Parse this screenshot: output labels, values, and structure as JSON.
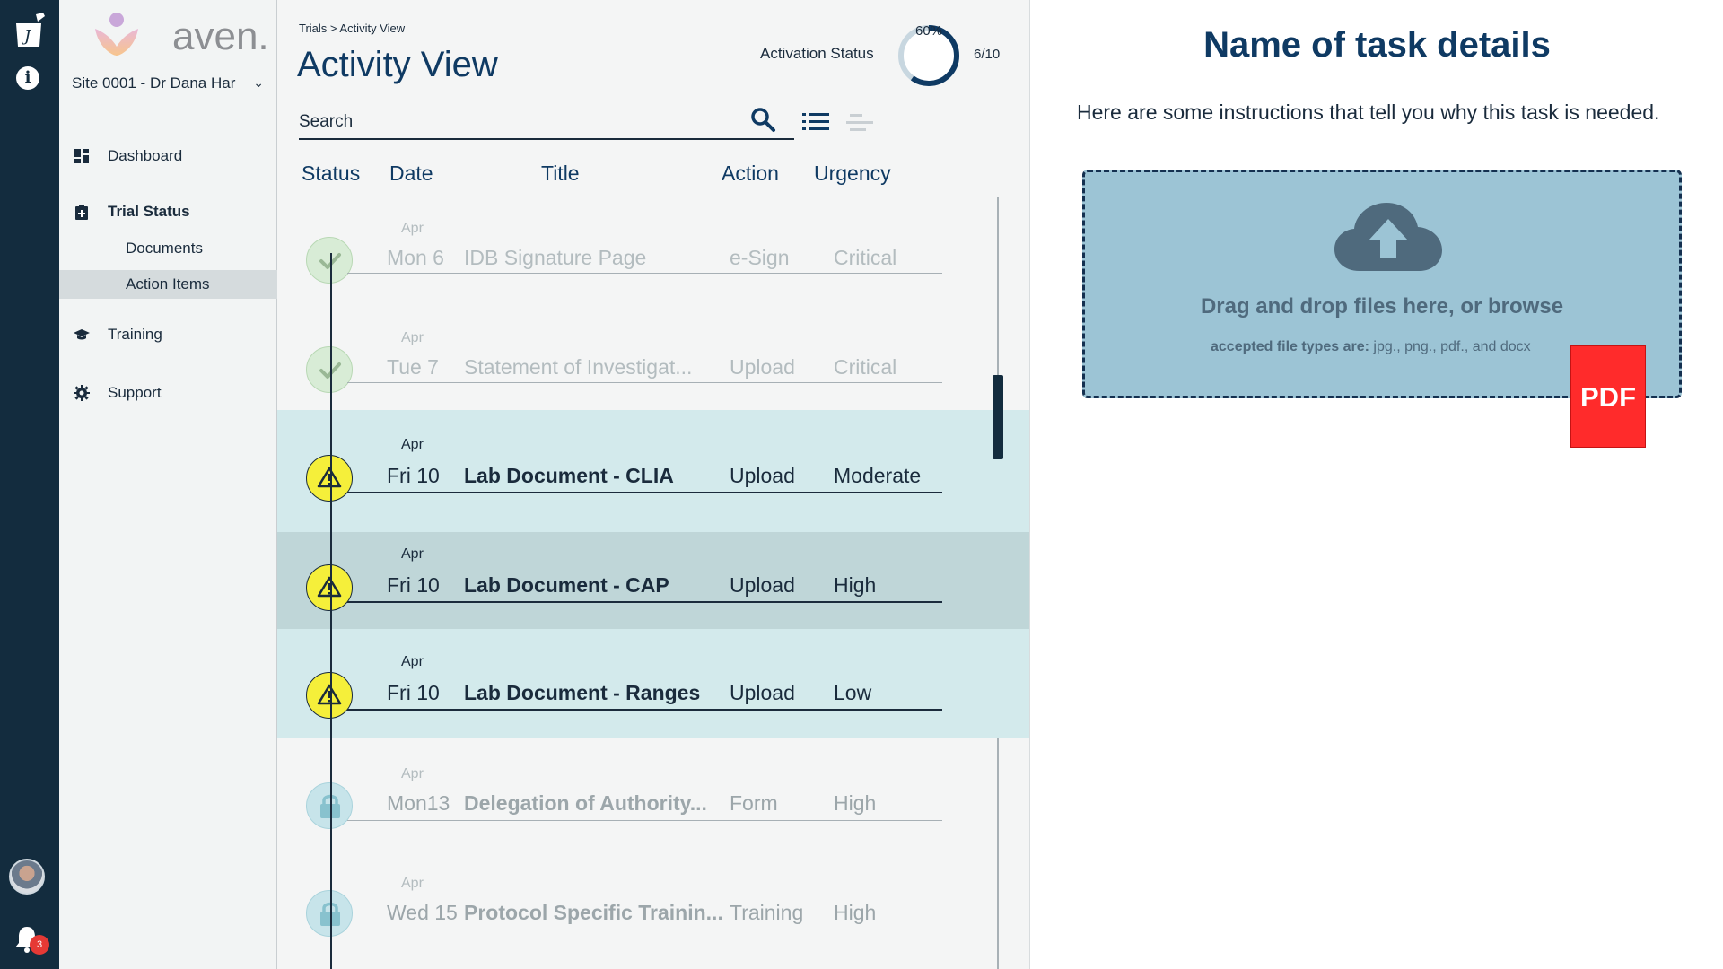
{
  "rail": {
    "logo_icon": "mortar-pestle-logo-icon",
    "info_icon": "info-icon",
    "info_glyph": "i",
    "avatar_icon": "user-avatar",
    "bell_icon": "bell-icon",
    "notification_count": "3"
  },
  "sidebar": {
    "brand": "aven.",
    "site_selector": "Site 0001 - Dr Dana Har",
    "site_chevron": "⌄",
    "nav": {
      "dashboard": "Dashboard",
      "trial_status": "Trial Status",
      "documents": "Documents",
      "action_items": "Action Items",
      "training": "Training",
      "support": "Support"
    }
  },
  "header": {
    "breadcrumb": "Trials > Activity View",
    "title": "Activity View",
    "activation_label": "Activation Status",
    "activation_percent_text": "60%",
    "activation_fraction": 0.6,
    "activation_count": "6/10",
    "search_placeholder": "Search"
  },
  "columns": {
    "status": "Status",
    "date": "Date",
    "title": "Title",
    "action": "Action",
    "urgency": "Urgency"
  },
  "rows": [
    {
      "month": "Apr",
      "day": "Mon 6",
      "title": "IDB Signature Page",
      "action": "e-Sign",
      "urgency": "Critical",
      "status": "complete"
    },
    {
      "month": "Apr",
      "day": "Tue 7",
      "title": "Statement of Investigat...",
      "action": "Upload",
      "urgency": "Critical",
      "status": "complete"
    },
    {
      "month": "Apr",
      "day": "Fri 10",
      "title": "Lab Document - CLIA",
      "action": "Upload",
      "urgency": "Moderate",
      "status": "warning"
    },
    {
      "month": "Apr",
      "day": "Fri 10",
      "title": "Lab Document - CAP",
      "action": "Upload",
      "urgency": "High",
      "status": "warning"
    },
    {
      "month": "Apr",
      "day": "Fri 10",
      "title": "Lab Document - Ranges",
      "action": "Upload",
      "urgency": "Low",
      "status": "warning"
    },
    {
      "month": "Apr",
      "day": "Mon13",
      "title": "Delegation of Authority...",
      "action": "Form",
      "urgency": "High",
      "status": "locked"
    },
    {
      "month": "Apr",
      "day": "Wed 15",
      "title": "Protocol Specific Trainin...",
      "action": "Training",
      "urgency": "High",
      "status": "locked"
    }
  ],
  "detail": {
    "title": "Name of task details",
    "description": "Here are some instructions that tell you why this task is needed.",
    "drop_text": "Drag and drop files here, or browse",
    "types_label": "accepted file types are:",
    "types_value": " jpg., png., pdf., and docx",
    "pdf_badge": "PDF"
  },
  "colors": {
    "rail": "#132c3e",
    "title": "#0f3a63",
    "highlight_row": "#d3eaec",
    "selected_row": "#bfd6d8",
    "warning": "#f5ef3a",
    "complete": "#d8ecd6",
    "locked": "#c7e4ea",
    "drop_zone": "#9cc4d5",
    "pdf_badge": "#ff2b2b"
  }
}
